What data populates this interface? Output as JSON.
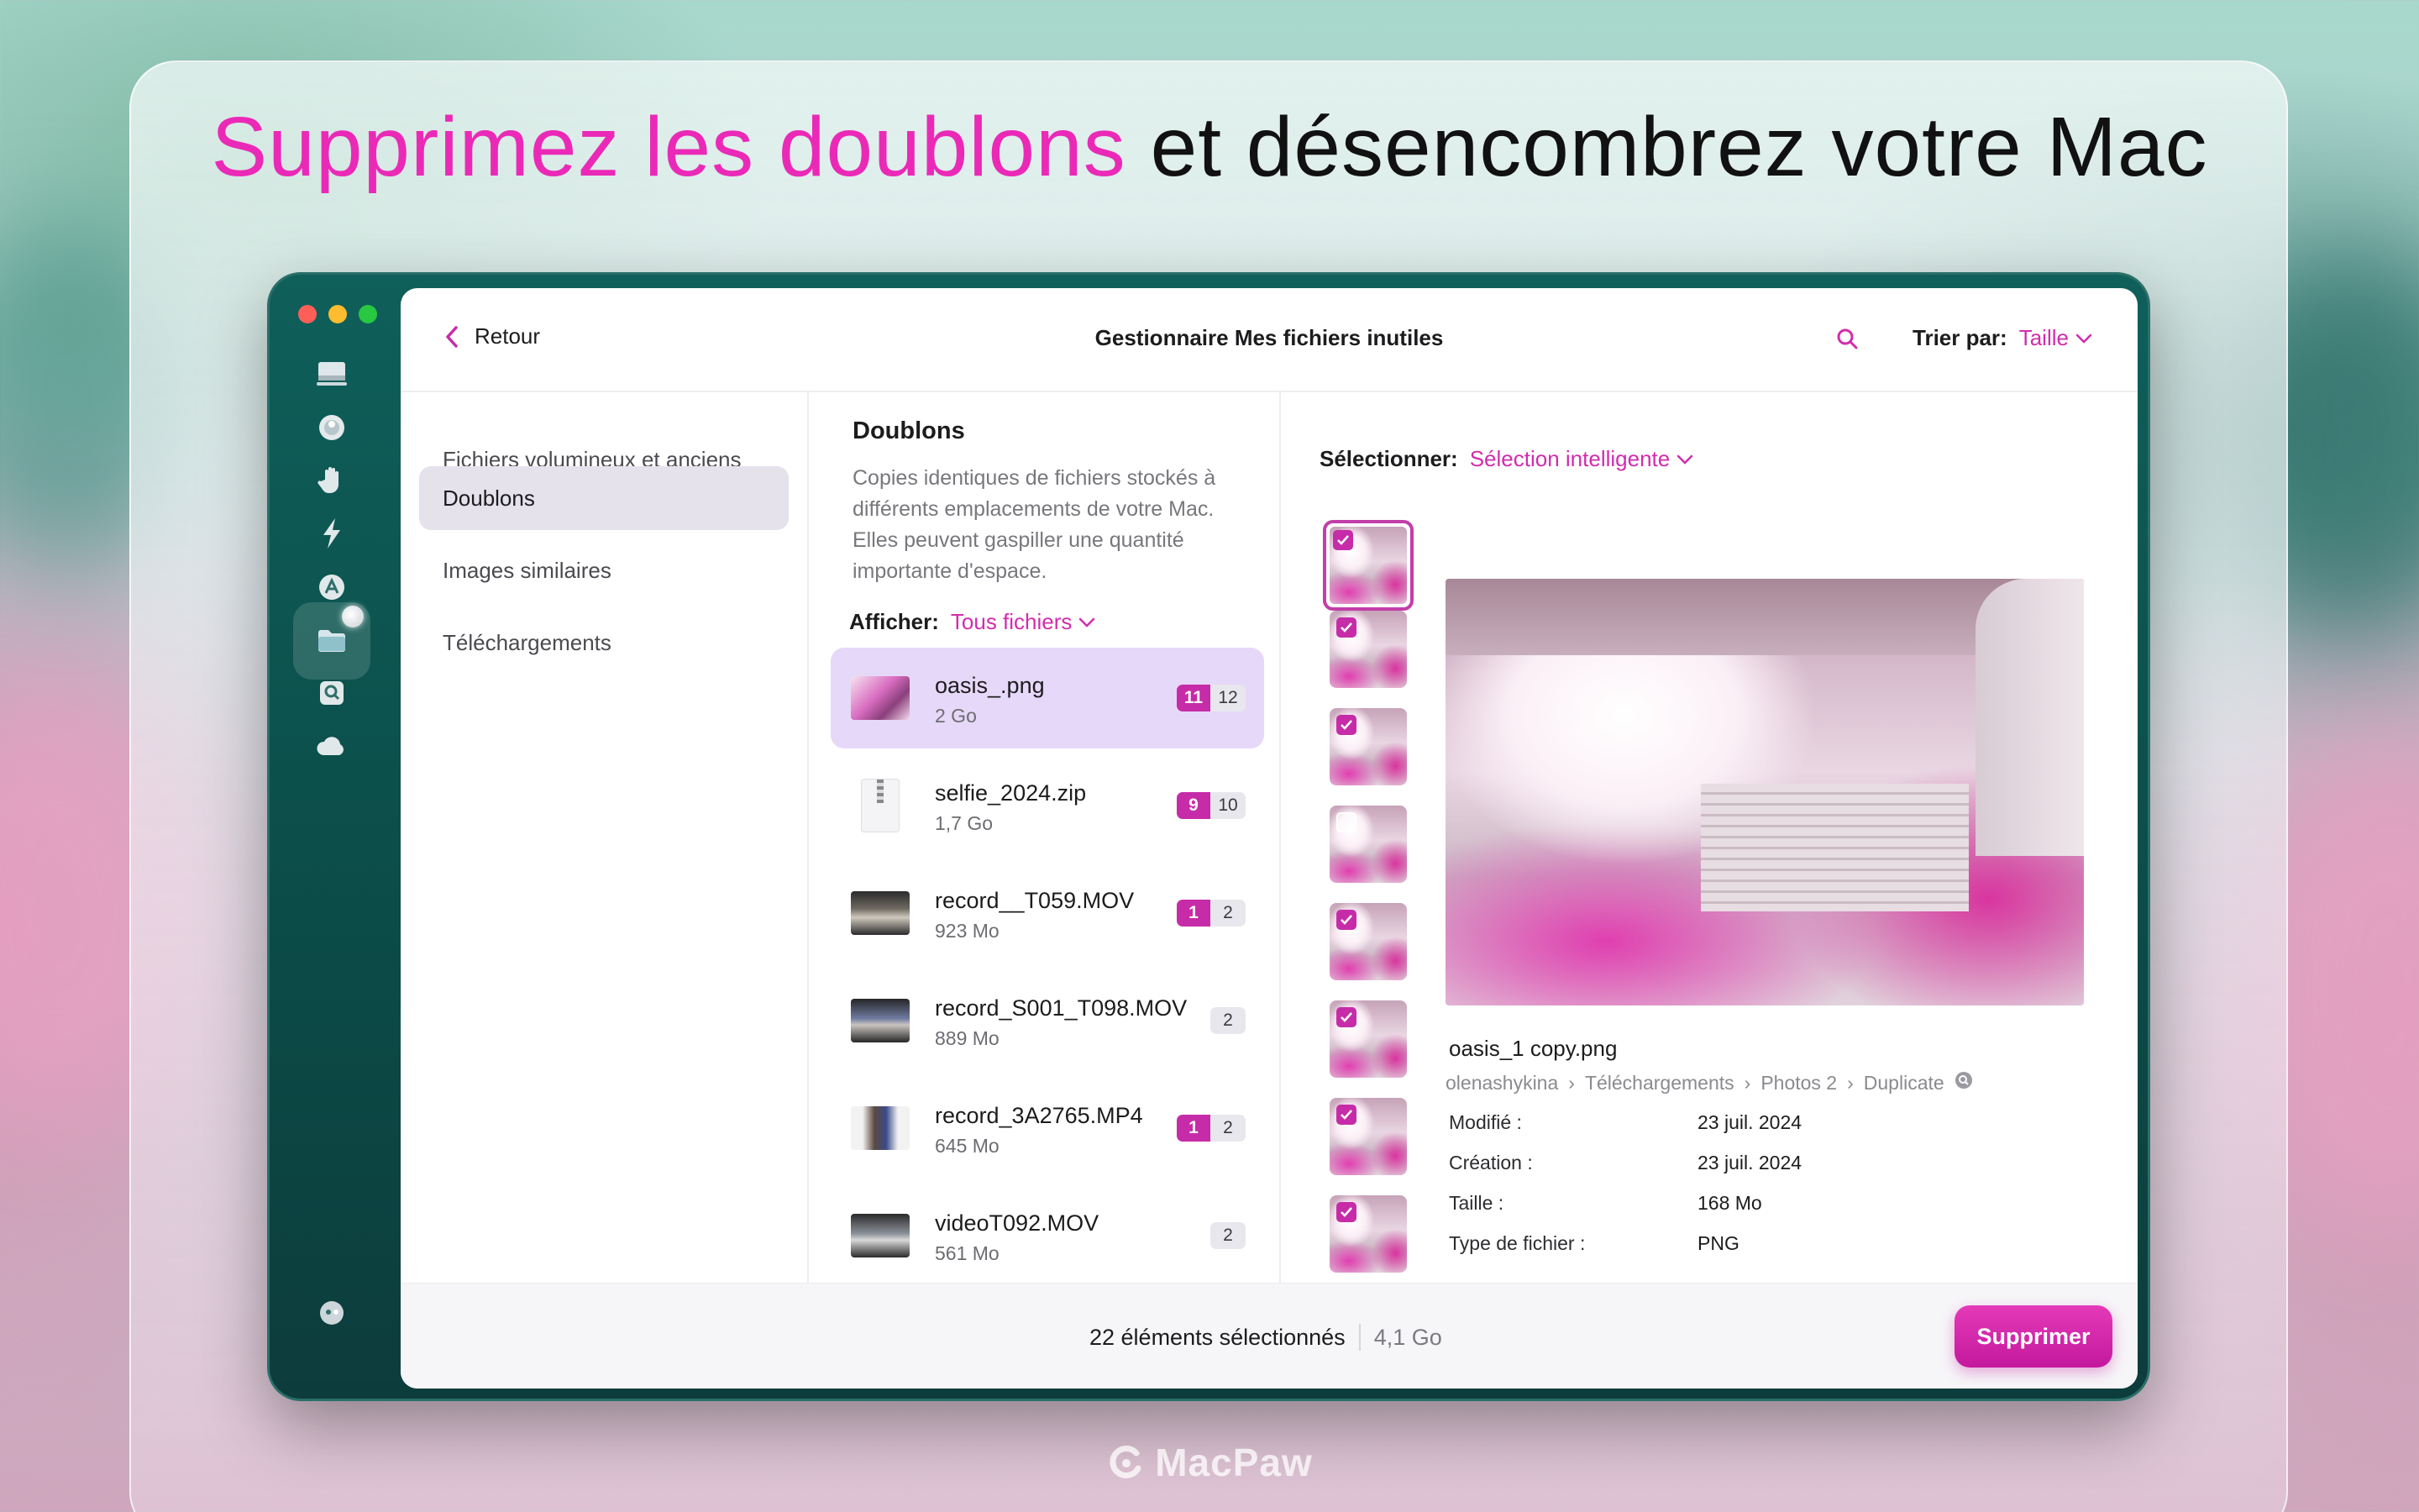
{
  "headline": {
    "accent": "Supprimez les doublons",
    "rest": "et désencombrez votre Mac"
  },
  "window": {
    "back_label": "Retour",
    "title": "Gestionnaire Mes fichiers inutiles",
    "sort": {
      "label": "Trier par:",
      "value": "Taille"
    }
  },
  "sidebar_icons": [
    "desktop-icon",
    "shield-icon",
    "hand-icon",
    "lightning-icon",
    "apps-icon",
    "folder-icon",
    "disk-search-icon",
    "cloud-icon",
    "assistant-icon"
  ],
  "categories": [
    {
      "label": "Fichiers volumineux et anciens"
    },
    {
      "label": "Doublons"
    },
    {
      "label": "Images similaires"
    },
    {
      "label": "Téléchargements"
    }
  ],
  "duplicates": {
    "title": "Doublons",
    "description": "Copies identiques de fichiers stockés à différents emplacements de votre Mac. Elles peuvent gaspiller une quantité importante d'espace.",
    "filter": {
      "label": "Afficher:",
      "value": "Tous fichiers"
    },
    "files": [
      {
        "name": "oasis_.png",
        "size": "2 Go",
        "selected": "11",
        "total": "12"
      },
      {
        "name": "selfie_2024.zip",
        "size": "1,7 Go",
        "selected": "9",
        "total": "10"
      },
      {
        "name": "record__T059.MOV",
        "size": "923 Mo",
        "selected": "1",
        "total": "2"
      },
      {
        "name": "record_S001_T098.MOV",
        "size": "889 Mo",
        "selected": "",
        "total": "2"
      },
      {
        "name": "record_3A2765.MP4",
        "size": "645 Mo",
        "selected": "1",
        "total": "2"
      },
      {
        "name": "videoT092.MOV",
        "size": "561 Mo",
        "selected": "",
        "total": "2"
      }
    ]
  },
  "detail": {
    "select": {
      "label": "Sélectionner:",
      "value": "Sélection intelligente"
    },
    "file_name": "oasis_1 copy.png",
    "path": [
      "olenashykina",
      "Téléchargements",
      "Photos 2",
      "Duplicate"
    ],
    "properties": [
      {
        "label": "Modifié :",
        "value": "23 juil. 2024"
      },
      {
        "label": "Création :",
        "value": "23 juil. 2024"
      },
      {
        "label": "Taille :",
        "value": "168 Mo"
      },
      {
        "label": "Type de fichier :",
        "value": "PNG"
      }
    ],
    "thumbnail_checked": [
      true,
      true,
      true,
      false,
      true,
      true,
      true,
      true
    ]
  },
  "footer": {
    "selected_text": "22 éléments sélectionnés",
    "selected_size": "4,1 Go",
    "delete_label": "Supprimer"
  },
  "brand": "MacPaw",
  "colors": {
    "accent": "#d22cae",
    "button": "#c4189d",
    "window_frame": "#0f5f5a",
    "selected_row": "#e6d8f8"
  }
}
